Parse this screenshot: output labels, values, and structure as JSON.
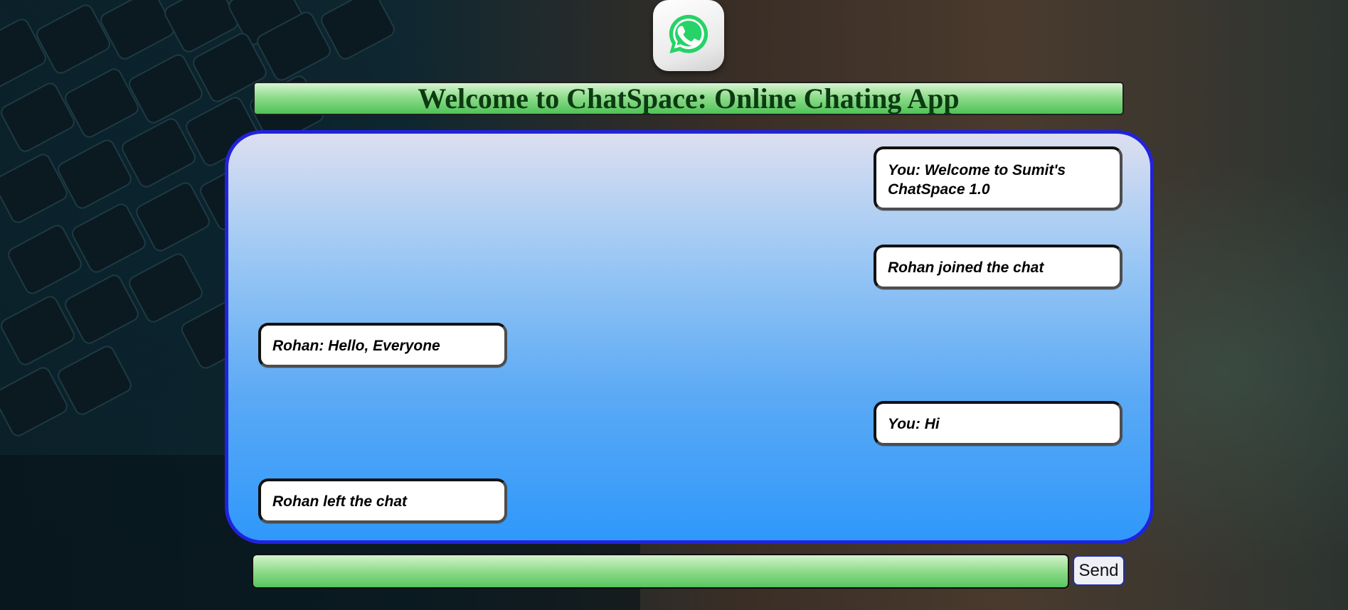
{
  "header": {
    "logo_icon": "whatsapp-icon",
    "title": "Welcome to ChatSpace: Online Chating App"
  },
  "messages": [
    {
      "text": "You: Welcome to Sumit's ChatSpace 1.0",
      "side": "right"
    },
    {
      "text": "Rohan joined the chat",
      "side": "right"
    },
    {
      "text": "Rohan: Hello, Everyone",
      "side": "left"
    },
    {
      "text": "You: Hi",
      "side": "right"
    },
    {
      "text": "Rohan left the chat",
      "side": "left"
    }
  ],
  "composer": {
    "input_value": "",
    "send_label": "Send"
  },
  "colors": {
    "title_green": "#4fc257",
    "chat_border": "#2222dd",
    "chat_bottom": "#2f98fb",
    "whatsapp_green": "#25d366"
  }
}
